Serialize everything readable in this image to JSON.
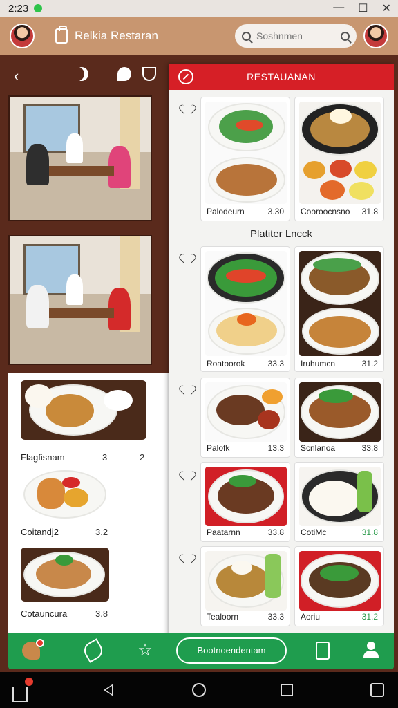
{
  "status": {
    "time": "2:23"
  },
  "window": {
    "minimize": "—",
    "maximize": "☐",
    "close": "✕"
  },
  "header": {
    "title": "Relkia Restaran",
    "search_placeholder": "Soshnmen"
  },
  "menu": {
    "title": "RESTAUANAN",
    "section_label": "Platiter Lncck",
    "items": [
      {
        "name": "Palodeurn",
        "price": "3.30"
      },
      {
        "name": "Cooroocnsno",
        "price": "31.8"
      },
      {
        "name": "Roatoorok",
        "price": "33.3"
      },
      {
        "name": "Iruhumcn",
        "price": "31.2"
      },
      {
        "name": "Palofk",
        "price": "13.3"
      },
      {
        "name": "Scnlanoa",
        "price": "33.8"
      },
      {
        "name": "Paatarnn",
        "price": "33.8"
      },
      {
        "name": "CotiMc",
        "price": "31.8"
      },
      {
        "name": "Tealoorn",
        "price": "33.3"
      },
      {
        "name": "Aoriu",
        "price": "31.2"
      }
    ]
  },
  "left_list": {
    "items": [
      {
        "name": "Flagfisnam",
        "price": "3",
        "extra": "2"
      },
      {
        "name": "Coitandj2",
        "price": "3.2"
      },
      {
        "name": "Cotauncura",
        "price": "3.8"
      }
    ]
  },
  "bottom_bar": {
    "button_label": "Bootnoendentam"
  },
  "colors": {
    "header": "#c89670",
    "menu_red": "#d61f26",
    "bottom_green": "#1f9d4e"
  }
}
